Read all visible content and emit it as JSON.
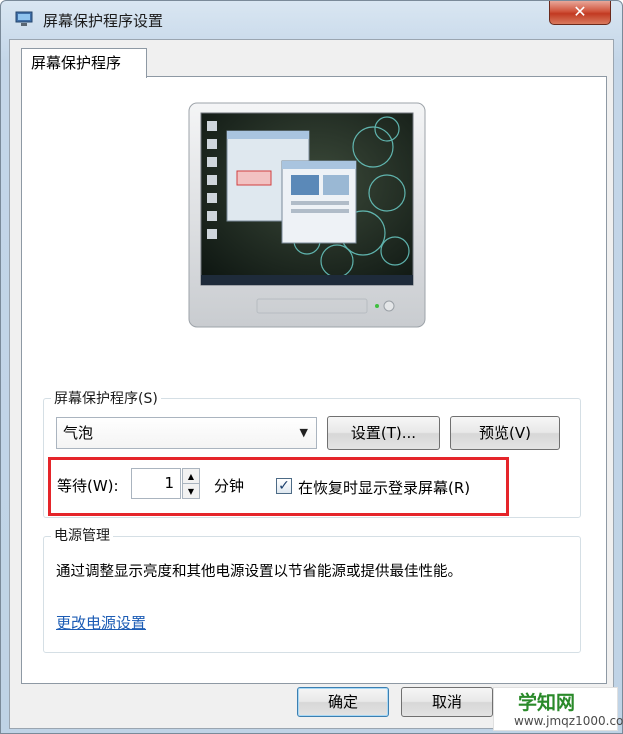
{
  "window": {
    "title": "屏幕保护程序设置",
    "close_label": "✕",
    "close_icon": "close-icon",
    "app_icon": "screensaver-monitor-icon"
  },
  "tabs": [
    {
      "label": "屏幕保护程序",
      "selected": true
    }
  ],
  "preview": {
    "icon": "monitor-preview-icon"
  },
  "screensaver_group": {
    "title": "屏幕保护程序(S)",
    "selected": "气泡",
    "settings_button": "设置(T)...",
    "preview_button": "预览(V)",
    "wait_label": "等待(W):",
    "wait_value": "1",
    "wait_unit": "分钟",
    "resume_checkbox_label": "在恢复时显示登录屏幕(R)",
    "resume_checked": true,
    "highlight_color": "#e5252a"
  },
  "power_group": {
    "title": "电源管理",
    "description": "通过调整显示亮度和其他电源设置以节省能源或提供最佳性能。",
    "link": "更改电源设置"
  },
  "footer": {
    "ok_button": "确定",
    "cancel_button": "取消"
  },
  "watermark": {
    "title": "学知网",
    "url": "www.jmqz1000.com"
  }
}
